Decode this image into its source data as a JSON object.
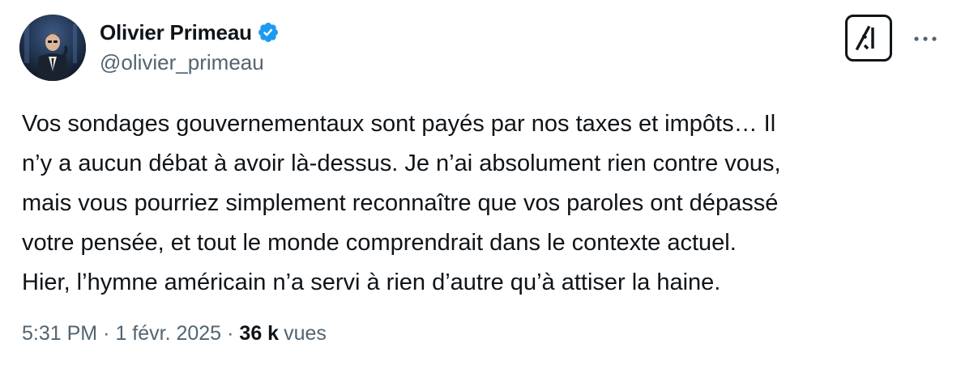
{
  "author": {
    "display_name": "Olivier Primeau",
    "handle": "@olivier_primeau",
    "verified_icon": "verified-badge-icon",
    "verified_color": "#1d9bf0",
    "avatar_icon": "avatar-photo"
  },
  "actions": {
    "grok_icon": "grok-icon",
    "more_icon": "more-dots-icon"
  },
  "tweet": {
    "lines": [
      "Vos sondages gouvernementaux sont payés par nos taxes et impôts… Il",
      "n’y a aucun débat à avoir là-dessus. Je n’ai absolument rien contre vous,",
      "mais vous pourriez simplement reconnaître que vos paroles ont dépassé",
      "votre pensée, et tout le monde comprendrait dans le contexte actuel.",
      "Hier, l’hymne américain n’a servi à rien d’autre qu’à attiser la haine."
    ]
  },
  "meta": {
    "time": "5:31 PM",
    "separator": "·",
    "date": "1 févr. 2025",
    "views_count": "36 k",
    "views_label": "vues"
  }
}
